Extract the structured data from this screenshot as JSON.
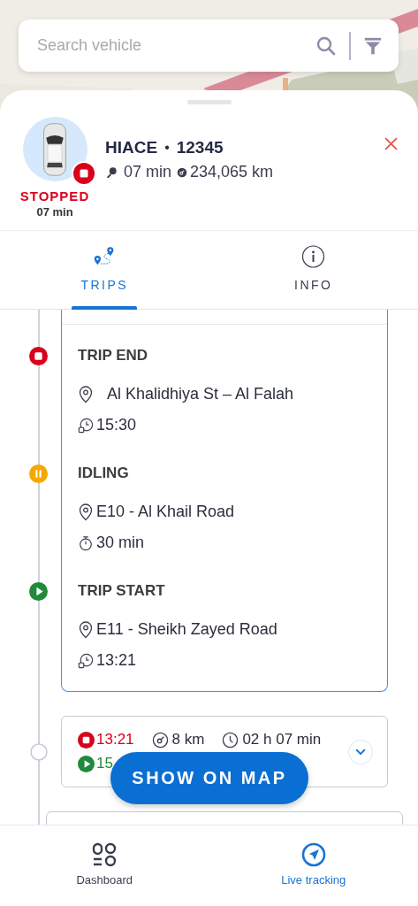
{
  "search": {
    "placeholder": "Search vehicle"
  },
  "vehicle": {
    "model": "HIACE",
    "separator": "•",
    "plate": "12345",
    "status": "STOPPED",
    "status_duration": "07 min",
    "ignition_duration": "07 min",
    "odometer": "234,065 km"
  },
  "tabs": [
    {
      "label": "TRIPS",
      "kind": "trips",
      "selected": true
    },
    {
      "label": "INFO",
      "kind": "info",
      "selected": false
    }
  ],
  "trip_events": [
    {
      "kind": "trip_end",
      "title": "TRIP END",
      "location": "Al Khalidhiya St – Al Falah",
      "time": "15:30"
    },
    {
      "kind": "idling",
      "title": "IDLING",
      "location": "E10 - Al Khail Road",
      "duration": "30 min"
    },
    {
      "kind": "trip_start",
      "title": "TRIP START",
      "location": "E11 - Sheikh Zayed Road",
      "time": "13:21"
    }
  ],
  "trip_summary": {
    "end_time": "13:21",
    "distance": "8 km",
    "duration": "02 h 07 min",
    "start_time": "15",
    "expanded": false
  },
  "show_on_map_button": "SHOW ON MAP",
  "bottom_nav": [
    {
      "label": "Dashboard",
      "kind": "dashboard",
      "selected": false
    },
    {
      "label": "Live tracking",
      "kind": "tracking",
      "selected": true
    }
  ]
}
